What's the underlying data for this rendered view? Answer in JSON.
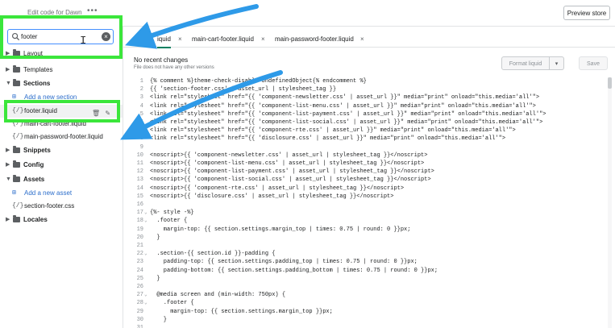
{
  "topbar": {
    "title": "Edit code for Dawn",
    "dots": "•••",
    "preview_label": "Preview store"
  },
  "search": {
    "value": "footer"
  },
  "sidebar": {
    "layout_label": "Layout",
    "templates_label": "Templates",
    "sections_label": "Sections",
    "add_section_label": "Add a new section",
    "footer_file": "footer.liquid",
    "cart_footer_file": "main-cart-footer.liquid",
    "password_footer_file": "main-password-footer.liquid",
    "snippets_label": "Snippets",
    "config_label": "Config",
    "assets_label": "Assets",
    "add_asset_label": "Add a new asset",
    "section_footer_css": "section-footer.css",
    "locales_label": "Locales"
  },
  "tabs": [
    {
      "label": "iquid"
    },
    {
      "label": "main-cart-footer.liquid"
    },
    {
      "label": "main-password-footer.liquid"
    }
  ],
  "status": {
    "title": "No recent changes",
    "subtitle": "File does not have any other versions"
  },
  "toolbar": {
    "format_label": "Format liquid",
    "save_label": "Save"
  },
  "colors": {
    "highlight": "#3be63b",
    "arrow": "#2e9ae8",
    "accent": "#008060"
  },
  "code_lines": [
    {
      "n": "1",
      "t": "{% comment %}theme-check-disable UndefinedObject{% endcomment %}"
    },
    {
      "n": "2",
      "t": "{{ 'section-footer.css' | asset_url | stylesheet_tag }}"
    },
    {
      "n": "3",
      "t": "<link rel=\"stylesheet\" href=\"{{ 'component-newsletter.css' | asset_url }}\" media=\"print\" onload=\"this.media='all'\">"
    },
    {
      "n": "4",
      "t": "<link rel=\"stylesheet\" href=\"{{ 'component-list-menu.css' | asset_url }}\" media=\"print\" onload=\"this.media='all'\">"
    },
    {
      "n": "5",
      "t": "<link rel=\"stylesheet\" href=\"{{ 'component-list-payment.css' | asset_url }}\" media=\"print\" onload=\"this.media='all'\">"
    },
    {
      "n": "6",
      "t": "<link rel=\"stylesheet\" href=\"{{ 'component-list-social.css' | asset_url }}\" media=\"print\" onload=\"this.media='all'\">"
    },
    {
      "n": "7",
      "t": "<link rel=\"stylesheet\" href=\"{{ 'component-rte.css' | asset_url }}\" media=\"print\" onload=\"this.media='all'\">"
    },
    {
      "n": "8",
      "t": "<link rel=\"stylesheet\" href=\"{{ 'disclosure.css' | asset_url }}\" media=\"print\" onload=\"this.media='all'\">"
    },
    {
      "n": "9",
      "t": ""
    },
    {
      "n": "10",
      "t": "<noscript>{{ 'component-newsletter.css' | asset_url | stylesheet_tag }}</noscript>"
    },
    {
      "n": "11",
      "t": "<noscript>{{ 'component-list-menu.css' | asset_url | stylesheet_tag }}</noscript>"
    },
    {
      "n": "12",
      "t": "<noscript>{{ 'component-list-payment.css' | asset_url | stylesheet_tag }}</noscript>"
    },
    {
      "n": "13",
      "t": "<noscript>{{ 'component-list-social.css' | asset_url | stylesheet_tag }}</noscript>"
    },
    {
      "n": "14",
      "t": "<noscript>{{ 'component-rte.css' | asset_url | stylesheet_tag }}</noscript>"
    },
    {
      "n": "15",
      "t": "<noscript>{{ 'disclosure.css' | asset_url | stylesheet_tag }}</noscript>"
    },
    {
      "n": "16",
      "t": ""
    },
    {
      "n": "17",
      "t": "{%- style -%}",
      "fold": true
    },
    {
      "n": "18",
      "t": "  .footer {",
      "fold": true
    },
    {
      "n": "19",
      "t": "    margin-top: {{ section.settings.margin_top | times: 0.75 | round: 0 }}px;"
    },
    {
      "n": "20",
      "t": "  }"
    },
    {
      "n": "21",
      "t": ""
    },
    {
      "n": "22",
      "t": "  .section-{{ section.id }}-padding {",
      "fold": true
    },
    {
      "n": "23",
      "t": "    padding-top: {{ section.settings.padding_top | times: 0.75 | round: 0 }}px;"
    },
    {
      "n": "24",
      "t": "    padding-bottom: {{ section.settings.padding_bottom | times: 0.75 | round: 0 }}px;"
    },
    {
      "n": "25",
      "t": "  }"
    },
    {
      "n": "26",
      "t": ""
    },
    {
      "n": "27",
      "t": "  @media screen and (min-width: 750px) {",
      "fold": true
    },
    {
      "n": "28",
      "t": "    .footer {",
      "fold": true
    },
    {
      "n": "29",
      "t": "      margin-top: {{ section.settings.margin_top }}px;"
    },
    {
      "n": "30",
      "t": "    }"
    },
    {
      "n": "31",
      "t": ""
    }
  ]
}
